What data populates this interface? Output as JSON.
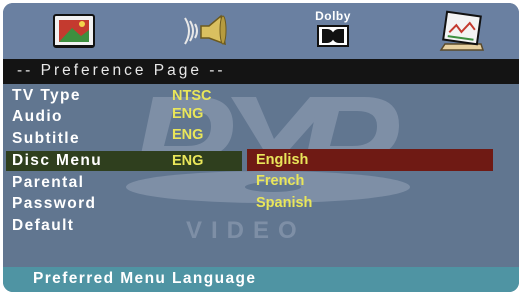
{
  "toolbar": {
    "icons": [
      {
        "name": "general-setup-icon"
      },
      {
        "name": "speaker-audio-icon"
      },
      {
        "name": "dolby-icon",
        "label": "Dolby"
      },
      {
        "name": "preference-board-icon"
      }
    ]
  },
  "page": {
    "title": "-- Preference Page --"
  },
  "menu": {
    "items": [
      {
        "label": "TV Type",
        "value": "NTSC"
      },
      {
        "label": "Audio",
        "value": "ENG"
      },
      {
        "label": "Subtitle",
        "value": "ENG"
      },
      {
        "label": "Disc Menu",
        "value": "ENG",
        "selected": true
      },
      {
        "label": "Parental"
      },
      {
        "label": "Password"
      },
      {
        "label": "Default"
      }
    ]
  },
  "submenu": {
    "options": [
      "English",
      "French",
      "Spanish"
    ],
    "selected_index": 0
  },
  "watermark": {
    "text": "VIDEO"
  },
  "status": {
    "text": "Preferred Menu Language"
  },
  "colors": {
    "panel": "#617690",
    "topbar": "#6a80a1",
    "title_bar": "#141414",
    "selection_bar": "#2f3f1e",
    "submenu_selection": "#6f1a14",
    "value_text": "#e9e65a",
    "status_bar": "#4f94a3"
  }
}
